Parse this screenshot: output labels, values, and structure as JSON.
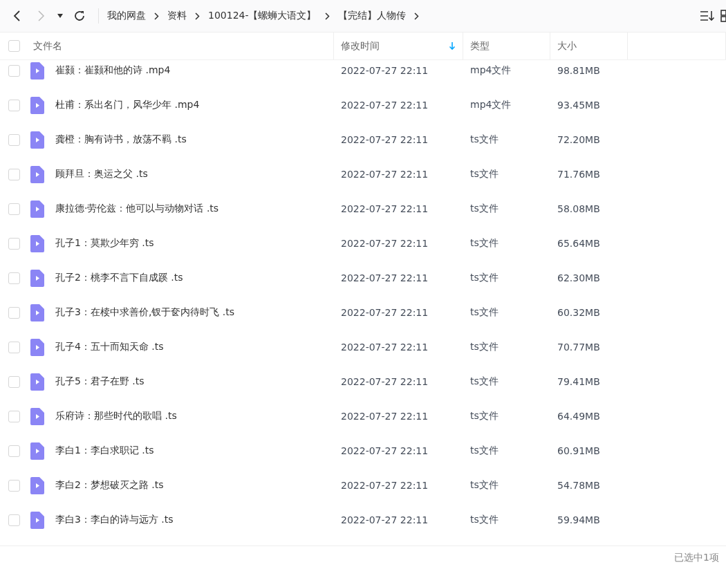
{
  "breadcrumb": [
    "我的网盘",
    "资料",
    "100124-【螺蛳大语文】",
    "【完结】人物传"
  ],
  "table": {
    "columns": [
      {
        "label": "文件名",
        "sorted": false
      },
      {
        "label": "修改时间",
        "sorted": true
      },
      {
        "label": "类型",
        "sorted": false
      },
      {
        "label": "大小",
        "sorted": false
      }
    ],
    "header_checked": false,
    "rows": [
      {
        "name": "崔颢：崔颢和他的诗 .mp4",
        "modified": "2022-07-27 22:11",
        "type": "mp4文件",
        "size": "98.81MB",
        "checked": false
      },
      {
        "name": "杜甫：系出名门，风华少年 .mp4",
        "modified": "2022-07-27 22:11",
        "type": "mp4文件",
        "size": "93.45MB",
        "checked": false
      },
      {
        "name": "龚橙：胸有诗书，放荡不羁 .ts",
        "modified": "2022-07-27 22:11",
        "type": "ts文件",
        "size": "72.20MB",
        "checked": false
      },
      {
        "name": "顾拜旦：奥运之父 .ts",
        "modified": "2022-07-27 22:11",
        "type": "ts文件",
        "size": "71.76MB",
        "checked": false
      },
      {
        "name": "康拉德·劳伦兹：他可以与动物对话 .ts",
        "modified": "2022-07-27 22:11",
        "type": "ts文件",
        "size": "58.08MB",
        "checked": false
      },
      {
        "name": "孔子1：莫欺少年穷 .ts",
        "modified": "2022-07-27 22:11",
        "type": "ts文件",
        "size": "65.64MB",
        "checked": false
      },
      {
        "name": "孔子2：桃李不言下自成蹊 .ts",
        "modified": "2022-07-27 22:11",
        "type": "ts文件",
        "size": "62.30MB",
        "checked": false
      },
      {
        "name": "孔子3：在椟中求善价,钗于奁内待时飞 .ts",
        "modified": "2022-07-27 22:11",
        "type": "ts文件",
        "size": "60.32MB",
        "checked": false
      },
      {
        "name": "孔子4：五十而知天命 .ts",
        "modified": "2022-07-27 22:11",
        "type": "ts文件",
        "size": "70.77MB",
        "checked": false
      },
      {
        "name": "孔子5：君子在野 .ts",
        "modified": "2022-07-27 22:11",
        "type": "ts文件",
        "size": "79.41MB",
        "checked": false
      },
      {
        "name": "乐府诗：那些时代的歌唱 .ts",
        "modified": "2022-07-27 22:11",
        "type": "ts文件",
        "size": "64.49MB",
        "checked": false
      },
      {
        "name": "李白1：李白求职记 .ts",
        "modified": "2022-07-27 22:11",
        "type": "ts文件",
        "size": "60.91MB",
        "checked": false
      },
      {
        "name": "李白2：梦想破灭之路 .ts",
        "modified": "2022-07-27 22:11",
        "type": "ts文件",
        "size": "54.78MB",
        "checked": false
      },
      {
        "name": "李白3：李白的诗与远方 .ts",
        "modified": "2022-07-27 22:11",
        "type": "ts文件",
        "size": "59.94MB",
        "checked": false
      }
    ]
  },
  "status_bar": {
    "selection": "已选中1项"
  }
}
